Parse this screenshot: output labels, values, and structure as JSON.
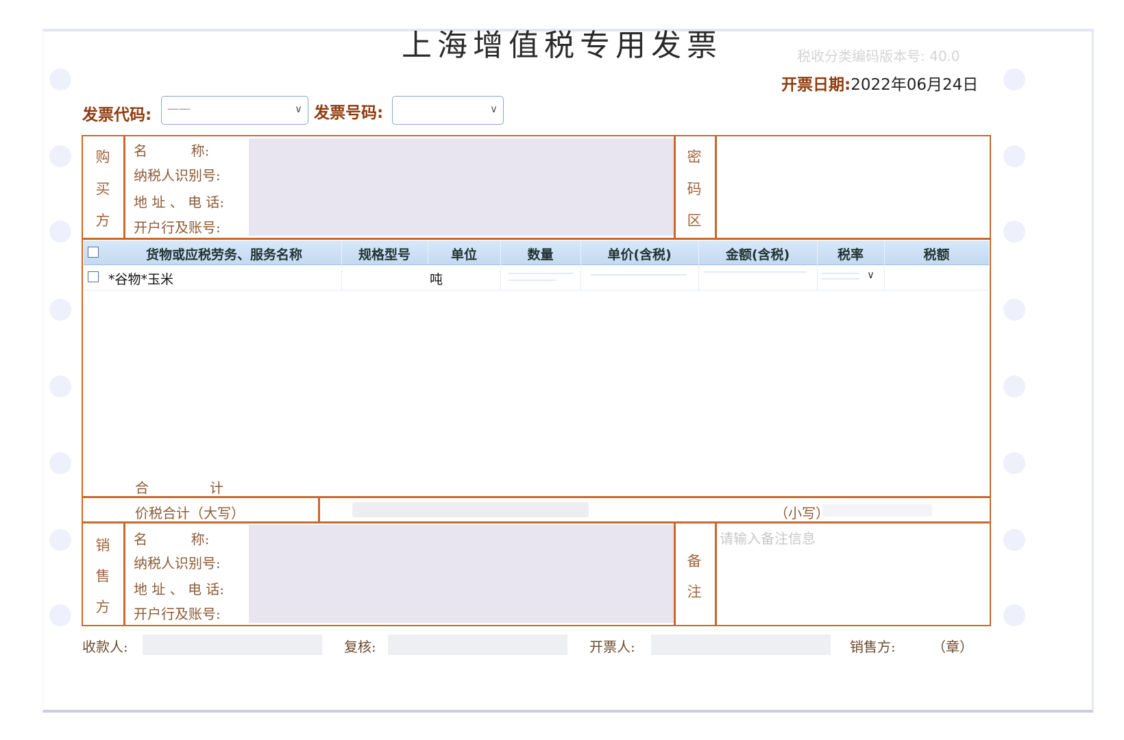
{
  "invoice": {
    "title": "上海增值税专用发票",
    "version_label": "税收分类编码版本号: 40.0",
    "code_label": "发票代码:",
    "code_value": "——",
    "number_label": "发票号码:",
    "number_value": "",
    "date_label": "开票日期:",
    "date_value": "2022年06月24日"
  },
  "buyer": {
    "section_label": [
      "购",
      "买",
      "方"
    ],
    "fields": [
      "名          称:",
      "纳税人识别号:",
      "地 址 、 电 话:",
      "开户行及账号:"
    ],
    "cipher_label": [
      "密",
      "码",
      "区"
    ]
  },
  "items": {
    "headers": [
      "货物或应税劳务、服务名称",
      "规格型号",
      "单位",
      "数量",
      "单价(含税)",
      "金额(含税)",
      "税率",
      "税额"
    ],
    "rows": [
      {
        "name": "*谷物*玉米",
        "spec": "",
        "unit": "吨",
        "qty": "",
        "price": "",
        "amount": "",
        "rate": "",
        "tax": ""
      }
    ],
    "total_label": "合              计"
  },
  "totals": {
    "capital_label": "价税合计（大写）",
    "small_label": "（小写）"
  },
  "seller": {
    "section_label": [
      "销",
      "售",
      "方"
    ],
    "fields": [
      "名          称:",
      "纳税人识别号:",
      "地 址 、 电 话:",
      "开户行及账号:"
    ],
    "remark_label": [
      "备",
      "注"
    ],
    "remark_placeholder": "请输入备注信息"
  },
  "footer": {
    "payee_label": "收款人:",
    "reviewer_label": "复核:",
    "issuer_label": "开票人:",
    "seller_label": "销售方:",
    "seal_label": "（章）"
  },
  "colors": {
    "border": "#c9682a",
    "label_brown": "#8e3c0e",
    "header_blue": "#c4daf1"
  }
}
